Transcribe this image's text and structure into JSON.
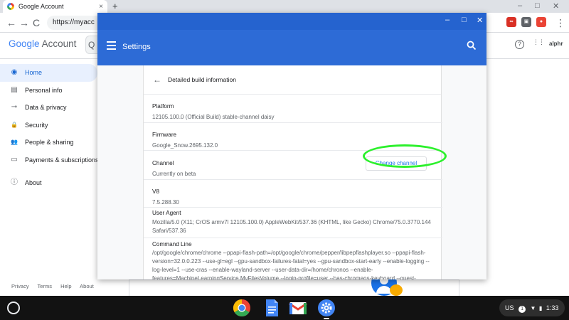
{
  "browser": {
    "tab_title": "Google Account",
    "tab_close": "×",
    "new_tab": "+",
    "url_partial": "https://myacc",
    "nav_back": "←",
    "nav_forward": "→",
    "nav_reload": "C",
    "window_controls": {
      "minimize": "–",
      "restore": "□",
      "close": "✕"
    }
  },
  "account_page": {
    "logo_word_google": "Google",
    "logo_word_account": "Account",
    "nav_items": [
      {
        "label": "Home",
        "icon": "account-circle-icon",
        "glyph": "◉",
        "active": true
      },
      {
        "label": "Personal info",
        "icon": "id-card-icon",
        "glyph": "▤",
        "active": false
      },
      {
        "label": "Data & privacy",
        "icon": "toggle-icon",
        "glyph": "⊸",
        "active": false
      },
      {
        "label": "Security",
        "icon": "lock-icon",
        "glyph": "🔒",
        "active": false
      },
      {
        "label": "People & sharing",
        "icon": "people-icon",
        "glyph": "👥",
        "active": false
      },
      {
        "label": "Payments & subscriptions",
        "icon": "credit-card-icon",
        "glyph": "▭",
        "active": false
      },
      {
        "label": "About",
        "icon": "info-icon",
        "glyph": "ⓘ",
        "active": false
      }
    ],
    "footer_links": [
      "Privacy",
      "Terms",
      "Help",
      "About"
    ],
    "help_glyph": "?",
    "apps_glyph": "⋮⋮",
    "avatar_text": "alphr"
  },
  "settings": {
    "header_title": "Settings",
    "page_title": "Detailed build information",
    "back_glyph": "←",
    "rows": [
      {
        "key": "Platform",
        "value": "12105.100.0 (Official Build) stable-channel daisy"
      },
      {
        "key": "Firmware",
        "value": "Google_Snow.2695.132.0"
      },
      {
        "key": "Channel",
        "value": "Currently on beta",
        "button": "Change channel"
      },
      {
        "key": "V8",
        "value": "7.5.288.30"
      },
      {
        "key": "User Agent",
        "value": "Mozilla/5.0 (X11; CrOS armv7l 12105.100.0) AppleWebKit/537.36 (KHTML, like Gecko) Chrome/75.0.3770.144 Safari/537.36"
      },
      {
        "key": "Command Line",
        "value": "/opt/google/chrome/chrome --ppapi-flash-path=/opt/google/chrome/pepper/libpepflashplayer.so --ppapi-flash-version=32.0.0.223 --use-gl=egl --gpu-sandbox-failures-fatal=yes --gpu-sandbox-start-early --enable-logging --log-level=1 --use-cras --enable-wayland-server --user-data-dir=/home/chronos --enable-features=MachineLearningService,MyFilesVolume --login-profile=user --has-chromeos-keyboard --guest-wallpaper-large=/usr/share/chromeos-assets/wallpaper/guest_large.jpg --guest-wallpaper-"
      }
    ]
  },
  "shelf": {
    "apps": [
      "Chrome",
      "Docs",
      "Gmail",
      "Settings"
    ],
    "status_locale": "US",
    "status_notifications": "1",
    "status_time": "1:33"
  },
  "colors": {
    "settings_blue": "#2d6bd6",
    "highlight_green": "#2cf02c",
    "nav_active_bg": "#e8f0fe",
    "link_blue": "#1a73e8"
  }
}
